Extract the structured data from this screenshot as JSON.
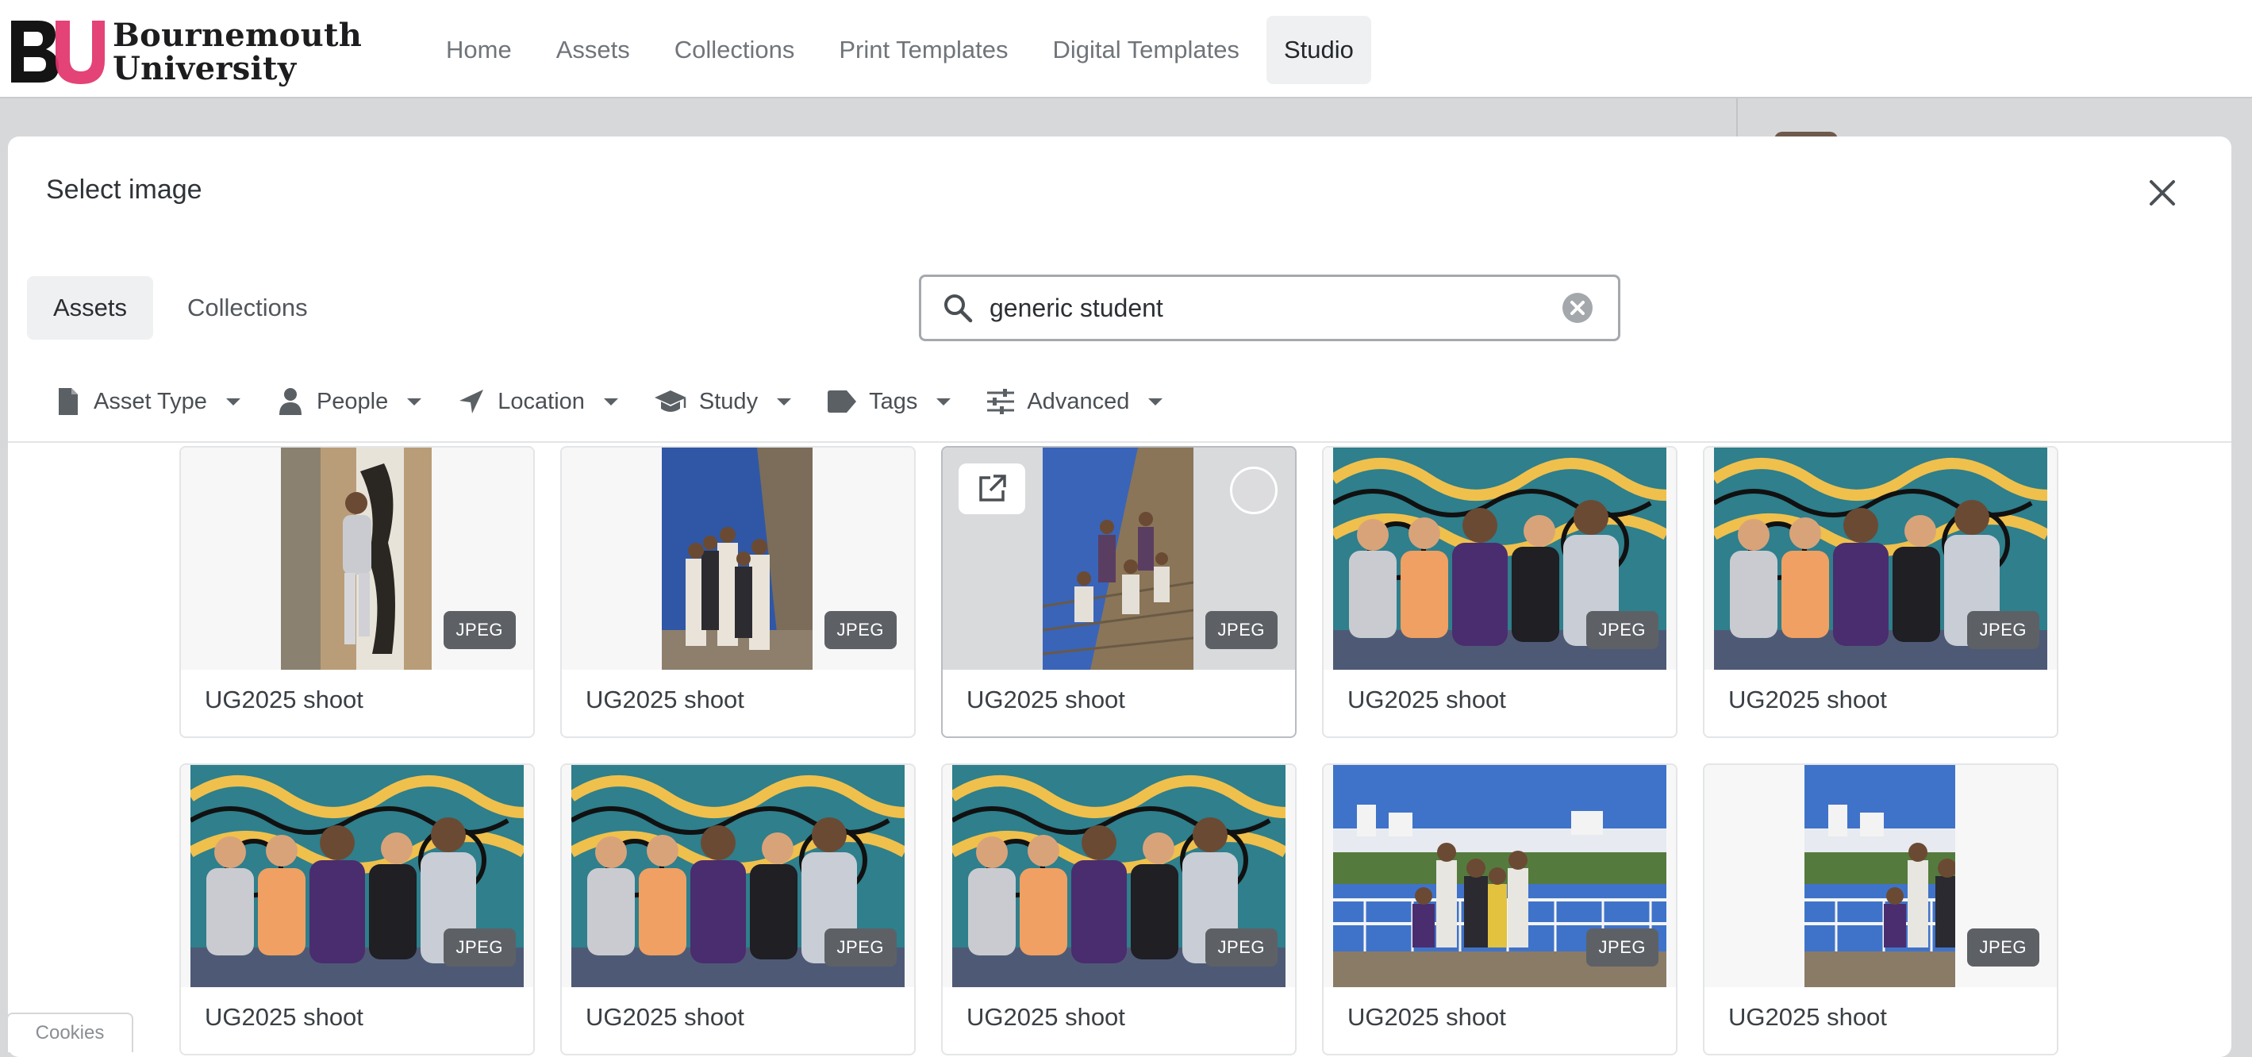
{
  "brand": {
    "line1": "Bournemouth",
    "line2": "University"
  },
  "nav": {
    "items": [
      "Home",
      "Assets",
      "Collections",
      "Print Templates",
      "Digital Templates",
      "Studio"
    ],
    "active": "Studio"
  },
  "modal": {
    "title": "Select image",
    "tabs": [
      {
        "label": "Assets",
        "active": true
      },
      {
        "label": "Collections",
        "active": false
      }
    ],
    "search": {
      "value": "generic student",
      "placeholder": ""
    },
    "filters": [
      {
        "label": "Asset Type",
        "icon": "document-icon"
      },
      {
        "label": "People",
        "icon": "person-icon"
      },
      {
        "label": "Location",
        "icon": "location-arrow-icon"
      },
      {
        "label": "Study",
        "icon": "graduation-cap-icon"
      },
      {
        "label": "Tags",
        "icon": "tag-icon"
      },
      {
        "label": "Advanced",
        "icon": "sliders-icon"
      }
    ],
    "assets": [
      {
        "label": "UG2025 shoot",
        "format": "JPEG",
        "orientation": "portrait",
        "scene": "pillar"
      },
      {
        "label": "UG2025 shoot",
        "format": "JPEG",
        "orientation": "portrait",
        "scene": "group-sky"
      },
      {
        "label": "UG2025 shoot",
        "format": "JPEG",
        "orientation": "portrait",
        "scene": "steps",
        "hovered": true
      },
      {
        "label": "UG2025 shoot",
        "format": "JPEG",
        "orientation": "landscape",
        "scene": "mural"
      },
      {
        "label": "UG2025 shoot",
        "format": "JPEG",
        "orientation": "landscape",
        "scene": "mural"
      },
      {
        "label": "UG2025 shoot",
        "format": "JPEG",
        "orientation": "landscape",
        "scene": "mural"
      },
      {
        "label": "UG2025 shoot",
        "format": "JPEG",
        "orientation": "landscape",
        "scene": "mural"
      },
      {
        "label": "UG2025 shoot",
        "format": "JPEG",
        "orientation": "landscape",
        "scene": "mural"
      },
      {
        "label": "UG2025 shoot",
        "format": "JPEG",
        "orientation": "landscape",
        "scene": "pier"
      },
      {
        "label": "UG2025 shoot",
        "format": "JPEG",
        "orientation": "portrait",
        "scene": "pier"
      }
    ]
  },
  "cookies": {
    "label": "Cookies"
  },
  "colors": {
    "brand_red": "#e2336b",
    "badge": "#5d6166",
    "nav_active_bg": "#eff0f1"
  }
}
